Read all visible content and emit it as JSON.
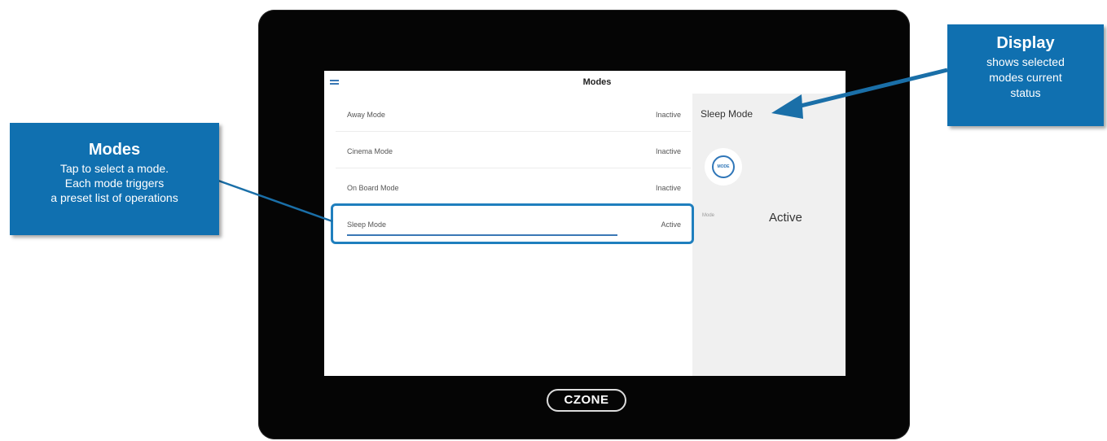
{
  "screen": {
    "title": "Modes",
    "menu_icon": "hamburger-icon",
    "modes": [
      {
        "name": "Away Mode",
        "status": "Inactive",
        "selected": false
      },
      {
        "name": "Cinema Mode",
        "status": "Inactive",
        "selected": false
      },
      {
        "name": "On Board Mode",
        "status": "Inactive",
        "selected": false
      },
      {
        "name": "Sleep Mode",
        "status": "Active",
        "selected": true
      }
    ],
    "panel": {
      "title": "Sleep  Mode",
      "button_label": "MODE",
      "mode_label": "Mode",
      "mode_value": "Active"
    }
  },
  "device": {
    "logo": "CZONE"
  },
  "callouts": {
    "modes": {
      "heading": "Modes",
      "lines": [
        "Tap to select a mode.",
        "Each mode triggers",
        "a preset list of operations"
      ]
    },
    "display": {
      "heading": "Display",
      "lines": [
        "shows selected",
        "modes current",
        "status"
      ]
    }
  },
  "colors": {
    "callout": "#1070b0",
    "accent": "#2f76b8",
    "frame": "#050505"
  }
}
